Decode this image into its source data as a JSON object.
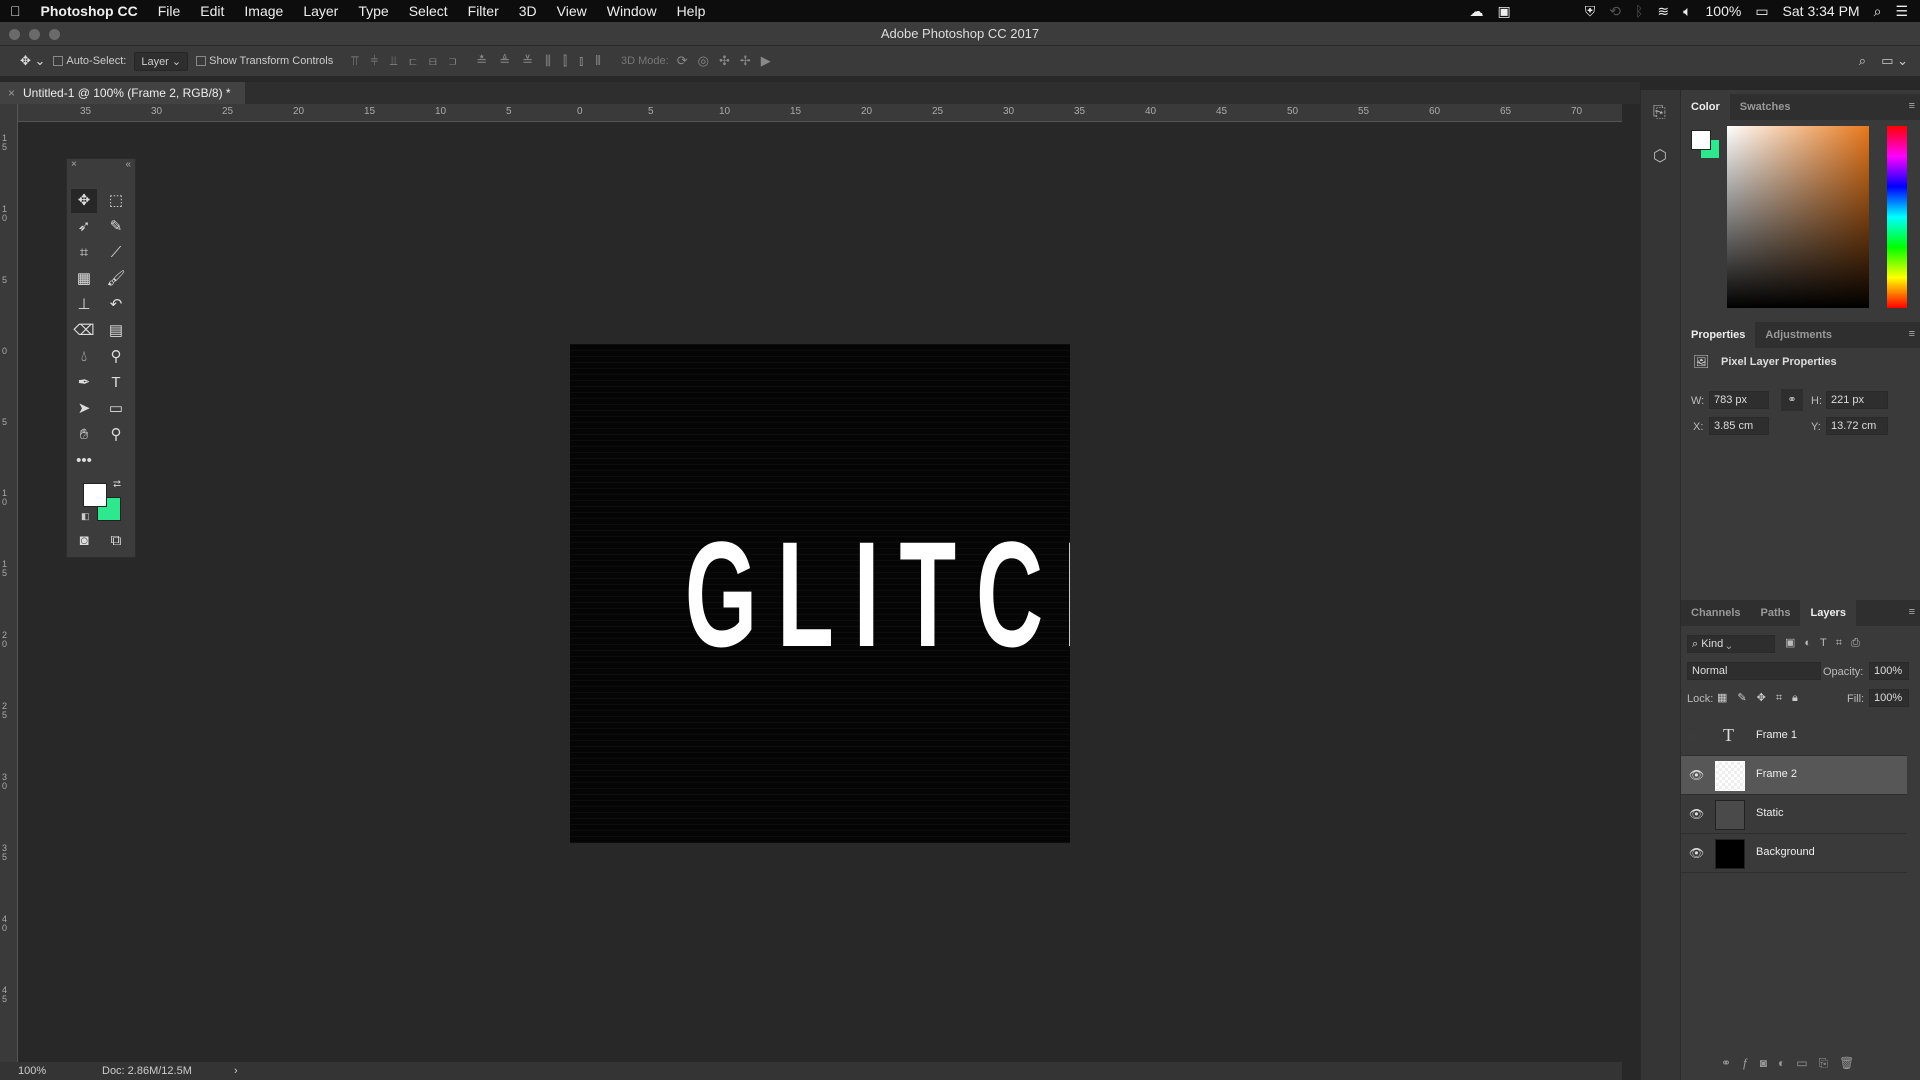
{
  "menubar": {
    "app": "Photoshop CC",
    "items": [
      "File",
      "Edit",
      "Image",
      "Layer",
      "Type",
      "Select",
      "Filter",
      "3D",
      "View",
      "Window",
      "Help"
    ],
    "battery": "100%",
    "clock": "Sat 3:34 PM"
  },
  "window": {
    "title": "Adobe Photoshop CC 2017"
  },
  "options": {
    "auto_select_label": "Auto-Select:",
    "auto_select_value": "Layer",
    "show_transform_label": "Show Transform Controls",
    "mode_3d_label": "3D Mode:"
  },
  "document": {
    "tab": "Untitled-1 @ 100% (Frame 2, RGB/8) *",
    "canvas_text": "GLITCH"
  },
  "ruler": {
    "h_labels": [
      "35",
      "30",
      "25",
      "20",
      "15",
      "10",
      "5",
      "0",
      "5",
      "10",
      "15",
      "20",
      "25",
      "30",
      "35",
      "40",
      "45",
      "50",
      "55",
      "60",
      "65",
      "70"
    ],
    "v_labels": [
      "15",
      "10",
      "5",
      "0",
      "5",
      "10",
      "15",
      "20",
      "25",
      "30",
      "35",
      "40",
      "45"
    ]
  },
  "toolbox": {
    "foreground": "#ffffff",
    "background": "#2ee88f"
  },
  "status": {
    "zoom": "100%",
    "doc": "Doc: 2.86M/12.5M",
    "arrow": "›"
  },
  "color_panel": {
    "tabs": [
      "Color",
      "Swatches"
    ],
    "foreground": "#ffffff",
    "background": "#2ee88f",
    "hue_base": "#e8781c"
  },
  "properties": {
    "tabs": [
      "Properties",
      "Adjustments"
    ],
    "title": "Pixel Layer Properties",
    "w_label": "W:",
    "w": "783 px",
    "h_label": "H:",
    "h": "221 px",
    "x_label": "X:",
    "x": "3.85 cm",
    "y_label": "Y:",
    "y": "13.72 cm"
  },
  "layers_panel": {
    "tabs": [
      "Channels",
      "Paths",
      "Layers"
    ],
    "filter": "Kind",
    "blend": "Normal",
    "opacity_label": "Opacity:",
    "opacity": "100%",
    "lock_label": "Lock:",
    "fill_label": "Fill:",
    "fill": "100%",
    "layers": [
      {
        "name": "Frame 1",
        "visible": false,
        "type": "text"
      },
      {
        "name": "Frame 2",
        "visible": true,
        "selected": true
      },
      {
        "name": "Static",
        "visible": true
      },
      {
        "name": "Background",
        "visible": true
      }
    ]
  }
}
